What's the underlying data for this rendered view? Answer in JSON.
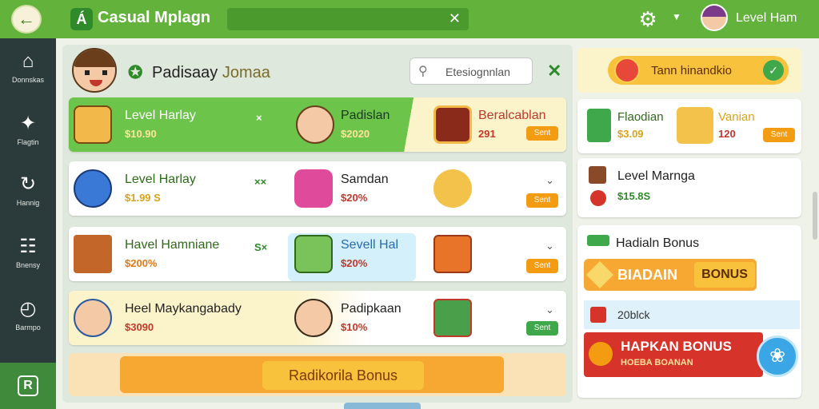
{
  "topbar": {
    "app_title": "Casual Mplagn",
    "app_logo_letter": "Á",
    "search_value": "",
    "user_name": "Level Ham",
    "back_icon": "➔",
    "close_glyph": "✕",
    "gear_glyph": "⚙"
  },
  "sidebar": {
    "items": [
      {
        "label": "Donnskas",
        "icon": "home-icon",
        "glyph": "⌂"
      },
      {
        "label": "Flagtin",
        "icon": "runner-icon",
        "glyph": "✦"
      },
      {
        "label": "Hannig",
        "icon": "refresh-icon",
        "glyph": "↻"
      },
      {
        "label": "Bnensy",
        "icon": "grid-icon",
        "glyph": "☷"
      },
      {
        "label": "Barmpo",
        "icon": "timer-icon",
        "glyph": "◴"
      }
    ],
    "active_letter": "R"
  },
  "main": {
    "header": {
      "title": "Padisaay",
      "title_suffix": "Jomaa",
      "search_placeholder": "Etesiognnlan"
    },
    "rows": [
      {
        "items": [
          {
            "name": "Level Harlay",
            "price": "$10.90",
            "mult": "×"
          },
          {
            "name": "Padislan",
            "price": "$2020"
          },
          {
            "name": "Beralcablan",
            "price": "291",
            "action": "Sent"
          }
        ]
      },
      {
        "items": [
          {
            "name": "Level Harlay",
            "price": "$1.99 S",
            "mult": "××"
          },
          {
            "name": "Samdan",
            "price": "$20%"
          },
          {
            "name": "",
            "price": "",
            "action": "Sent"
          }
        ]
      },
      {
        "items": [
          {
            "name": "Havel Hamniane",
            "price": "$200%",
            "mult": "S×"
          },
          {
            "name": "Sevell Hal",
            "price": "$20%"
          },
          {
            "name": "",
            "price": "",
            "action": "Sent"
          }
        ]
      },
      {
        "items": [
          {
            "name": "Heel Maykangabady",
            "price": "$3090",
            "mult": ""
          },
          {
            "name": "Padipkaan",
            "price": "$10%"
          },
          {
            "name": "",
            "price": "",
            "action": "Sent"
          }
        ]
      }
    ],
    "bonus_button": "Radikorila Bonus"
  },
  "right": {
    "banner_text": "Tann hinandkio",
    "card1": {
      "left_name": "Flaodian",
      "left_price": "$3.09",
      "right_name": "Vanian",
      "right_price": "120",
      "action": "Sent"
    },
    "card2": {
      "name": "Level Marnga",
      "price": "$15.8S"
    },
    "bonus_title": "Hadialn Bonus",
    "bonus_left": "BIADAIN",
    "bonus_right": "BONUS",
    "pick_text": "20blck",
    "red_title": "HAPKAN BONUS",
    "red_sub": "HOEBA BOANAN"
  },
  "colors": {
    "topbar": "#62b23c",
    "sidebar": "#2b3a3a",
    "accent_orange": "#f6a833",
    "accent_yellow": "#f9c23d",
    "accent_red": "#d6342a",
    "accent_blue": "#3aa6e6"
  }
}
